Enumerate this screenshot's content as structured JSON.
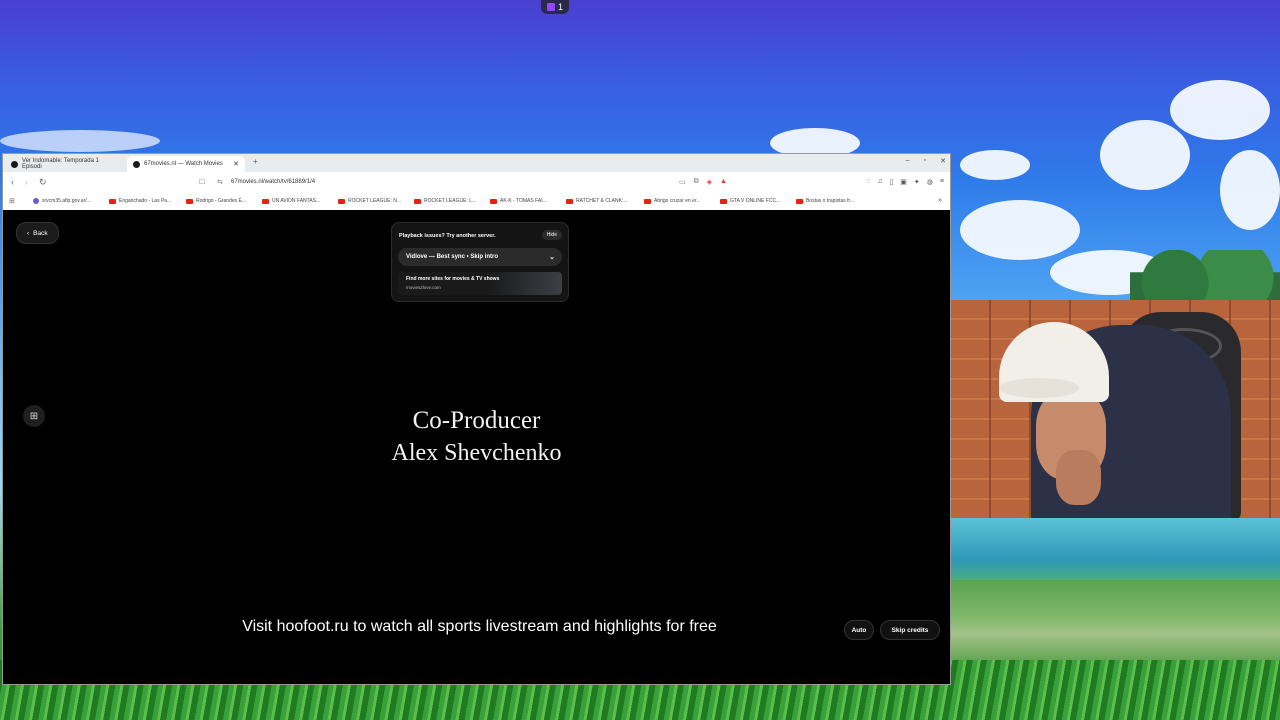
{
  "taskbar": {
    "twitch_count": "1"
  },
  "browser": {
    "tabs": [
      {
        "title": "Ver Indomable: Temporada 1 Episodi",
        "active": false
      },
      {
        "title": "67movies.nl — Watch Movies",
        "active": true
      }
    ],
    "new_tab": "+",
    "window_controls": [
      "–",
      "▫",
      "✕"
    ],
    "url": "67movies.nl/watch/tv/61889/1/4",
    "bookmarks": [
      {
        "label": "srvcm35.afip.gov.ar/...",
        "icon": "globe-icon"
      },
      {
        "label": "Enganchado - Las Pa...",
        "icon": "youtube-icon"
      },
      {
        "label": "Rodrigo - Grandes É...",
        "icon": "youtube-icon"
      },
      {
        "label": "UN AVION FANTAS...",
        "icon": "youtube-icon"
      },
      {
        "label": "ROCKET LEAGUE: N...",
        "icon": "youtube-icon"
      },
      {
        "label": "ROCKET LEAGUE: L...",
        "icon": "youtube-icon"
      },
      {
        "label": "AK-K - TOMAS FAI...",
        "icon": "youtube-icon"
      },
      {
        "label": "RATCHET & CLANK:...",
        "icon": "youtube-icon"
      },
      {
        "label": "Abrigo cruzar en er...",
        "icon": "youtube-icon"
      },
      {
        "label": "GTA V ONLINE FCC...",
        "icon": "youtube-icon"
      },
      {
        "label": "Bostas o trapistas fr...",
        "icon": "youtube-icon"
      }
    ]
  },
  "player": {
    "back_label": "Back",
    "server_panel": {
      "title": "Playback issues? Try another server.",
      "hide_label": "Hide",
      "selected_server": "Vidlove — Best sync • Skip intro",
      "promo_title": "Find more sites for movies & TV shows",
      "promo_site": "movies2love.com"
    },
    "credit_role": "Co-Producer",
    "credit_name": "Alex Shevchenko",
    "subtitle": "Visit hoofoot.ru to watch all sports livestream and highlights for free",
    "quality_label": "Auto",
    "skip_label": "Skip credits"
  },
  "colors": {
    "player_bg": "#000000",
    "browser_chrome": "#e9ecef",
    "youtube_red": "#e62117",
    "twitch_purple": "#9146ff"
  }
}
